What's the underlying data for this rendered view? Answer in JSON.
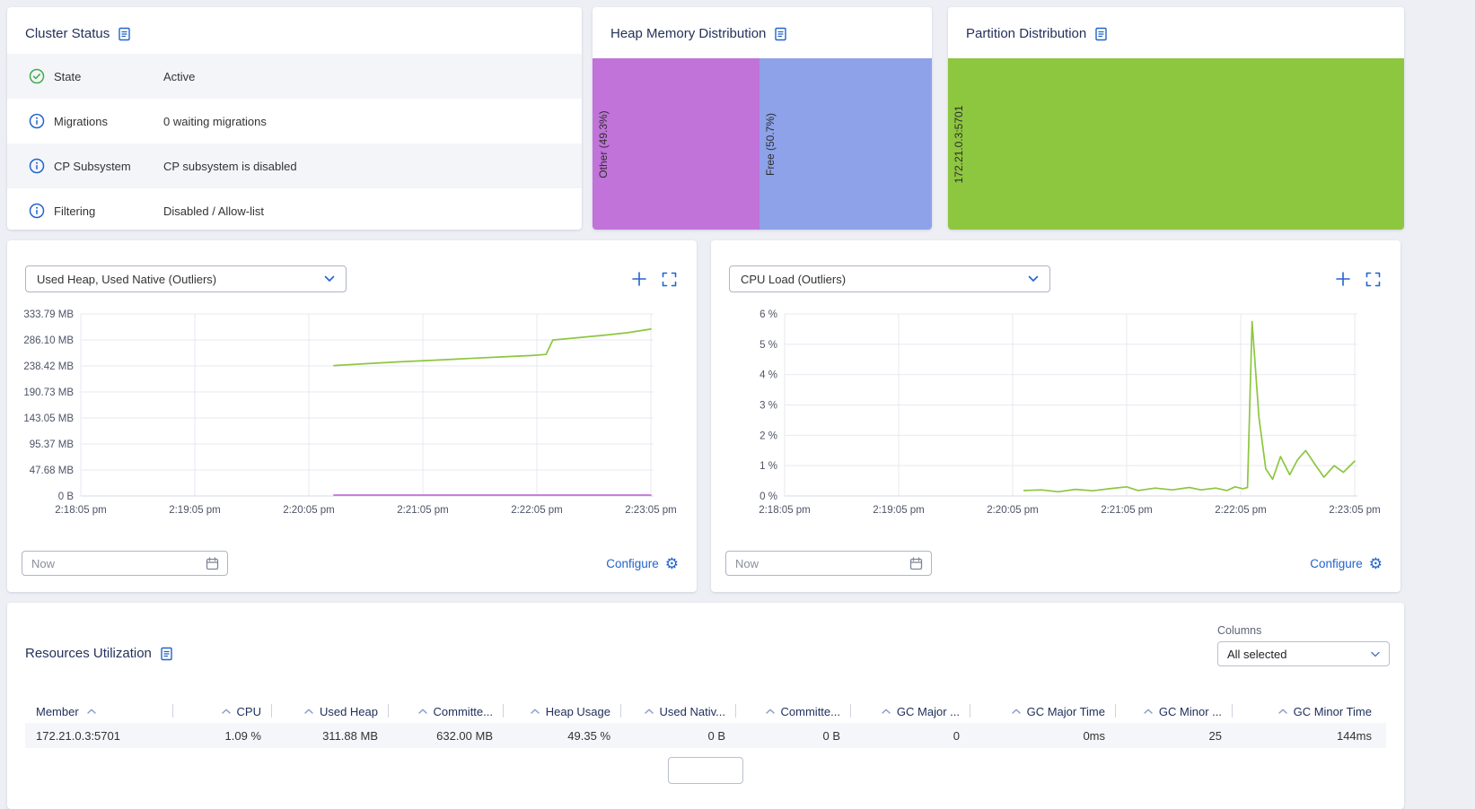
{
  "colors": {
    "accent_blue": "#2264cc",
    "success_green": "#3fae4c",
    "chart_green": "#8dc63f",
    "chart_purple": "#c173d9",
    "chart_periwinkle": "#8da2e8",
    "page_background": "#edeff5"
  },
  "cluster_status": {
    "title": "Cluster Status",
    "rows": [
      {
        "icon": "check-circle",
        "label": "State",
        "value": "Active"
      },
      {
        "icon": "info-circle",
        "label": "Migrations",
        "value": "0 waiting migrations"
      },
      {
        "icon": "info-circle",
        "label": "CP Subsystem",
        "value": "CP subsystem is disabled"
      },
      {
        "icon": "info-circle",
        "label": "Filtering",
        "value": "Disabled / Allow-list"
      }
    ]
  },
  "heap_memory_distribution": {
    "title": "Heap Memory Distribution",
    "segments": [
      {
        "label": "Other (49.3%)",
        "percent": 49.3,
        "color": "#c173d9"
      },
      {
        "label": "Free (50.7%)",
        "percent": 50.7,
        "color": "#8da2e8"
      }
    ]
  },
  "partition_distribution": {
    "title": "Partition Distribution",
    "segments": [
      {
        "label": "172.21.0.3:5701",
        "percent": 100,
        "color": "#8dc63f"
      }
    ]
  },
  "metric_panels": [
    {
      "metric_selector": "Used Heap, Used Native (Outliers)",
      "time_value": "Now",
      "configure_label": "Configure"
    },
    {
      "metric_selector": "CPU Load (Outliers)",
      "time_value": "Now",
      "configure_label": "Configure"
    }
  ],
  "chart_data": [
    {
      "type": "line",
      "title": "Used Heap, Used Native (Outliers)",
      "x_ticks": [
        "2:18:05 pm",
        "2:19:05 pm",
        "2:20:05 pm",
        "2:21:05 pm",
        "2:22:05 pm",
        "2:23:05 pm"
      ],
      "x_tick_positions": [
        0,
        1,
        2,
        3,
        4,
        5
      ],
      "x_range": [
        0,
        5
      ],
      "y_range": [
        0,
        333.79
      ],
      "y_unit": "MB",
      "grid": true,
      "legend": "none",
      "y_ticks": [
        {
          "value": 333.79,
          "label": "333.79 MB"
        },
        {
          "value": 286.1,
          "label": "286.10 MB"
        },
        {
          "value": 238.42,
          "label": "238.42 MB"
        },
        {
          "value": 190.73,
          "label": "190.73 MB"
        },
        {
          "value": 143.05,
          "label": "143.05 MB"
        },
        {
          "value": 95.37,
          "label": "95.37 MB"
        },
        {
          "value": 47.68,
          "label": "47.68 MB"
        },
        {
          "value": 0,
          "label": "0 B"
        }
      ],
      "series": [
        {
          "name": "Used Heap",
          "color": "#8dc63f",
          "points": [
            [
              2.22,
              239
            ],
            [
              2.5,
              242.5
            ],
            [
              2.8,
              246
            ],
            [
              3.1,
              249
            ],
            [
              3.4,
              252
            ],
            [
              3.7,
              255
            ],
            [
              3.95,
              257.5
            ],
            [
              4.08,
              259.5
            ],
            [
              4.14,
              286
            ],
            [
              4.35,
              290
            ],
            [
              4.6,
              295
            ],
            [
              4.8,
              299.5
            ],
            [
              5.0,
              306
            ]
          ]
        },
        {
          "name": "Used Native",
          "color": "#c173d9",
          "points": [
            [
              2.22,
              1.6
            ],
            [
              3.0,
              1.6
            ],
            [
              4.0,
              1.6
            ],
            [
              5.0,
              1.6
            ]
          ]
        }
      ]
    },
    {
      "type": "line",
      "title": "CPU Load (Outliers)",
      "x_ticks": [
        "2:18:05 pm",
        "2:19:05 pm",
        "2:20:05 pm",
        "2:21:05 pm",
        "2:22:05 pm",
        "2:23:05 pm"
      ],
      "x_tick_positions": [
        0,
        1,
        2,
        3,
        4,
        5
      ],
      "x_range": [
        0,
        5
      ],
      "y_range": [
        0,
        6
      ],
      "y_unit": "%",
      "grid": true,
      "legend": "none",
      "y_ticks": [
        {
          "value": 6,
          "label": "6 %"
        },
        {
          "value": 5,
          "label": "5 %"
        },
        {
          "value": 4,
          "label": "4 %"
        },
        {
          "value": 3,
          "label": "3 %"
        },
        {
          "value": 2,
          "label": "2 %"
        },
        {
          "value": 1,
          "label": "1 %"
        },
        {
          "value": 0,
          "label": "0 %"
        }
      ],
      "series": [
        {
          "name": "CPU Load",
          "color": "#8dc63f",
          "points": [
            [
              2.1,
              0.18
            ],
            [
              2.25,
              0.2
            ],
            [
              2.4,
              0.14
            ],
            [
              2.55,
              0.22
            ],
            [
              2.7,
              0.17
            ],
            [
              2.85,
              0.24
            ],
            [
              3.0,
              0.3
            ],
            [
              3.1,
              0.18
            ],
            [
              3.25,
              0.26
            ],
            [
              3.4,
              0.2
            ],
            [
              3.55,
              0.28
            ],
            [
              3.65,
              0.2
            ],
            [
              3.78,
              0.26
            ],
            [
              3.88,
              0.18
            ],
            [
              3.95,
              0.3
            ],
            [
              4.02,
              0.24
            ],
            [
              4.06,
              0.28
            ],
            [
              4.1,
              5.75
            ],
            [
              4.16,
              2.6
            ],
            [
              4.22,
              0.9
            ],
            [
              4.28,
              0.55
            ],
            [
              4.35,
              1.3
            ],
            [
              4.43,
              0.7
            ],
            [
              4.5,
              1.2
            ],
            [
              4.57,
              1.5
            ],
            [
              4.65,
              1.05
            ],
            [
              4.73,
              0.62
            ],
            [
              4.82,
              1.0
            ],
            [
              4.9,
              0.78
            ],
            [
              5.0,
              1.15
            ]
          ]
        }
      ]
    }
  ],
  "resources_utilization": {
    "title": "Resources Utilization",
    "columns_label": "Columns",
    "columns_value": "All selected",
    "headers": [
      "Member",
      "CPU",
      "Used Heap",
      "Committe...",
      "Heap Usage",
      "Used Nativ...",
      "Committe...",
      "GC Major ...",
      "GC Major Time",
      "GC Minor ...",
      "GC Minor Time"
    ],
    "rows": [
      [
        "172.21.0.3:5701",
        "1.09 %",
        "311.88 MB",
        "632.00 MB",
        "49.35 %",
        "0 B",
        "0 B",
        "0",
        "0ms",
        "25",
        "144ms"
      ]
    ]
  }
}
